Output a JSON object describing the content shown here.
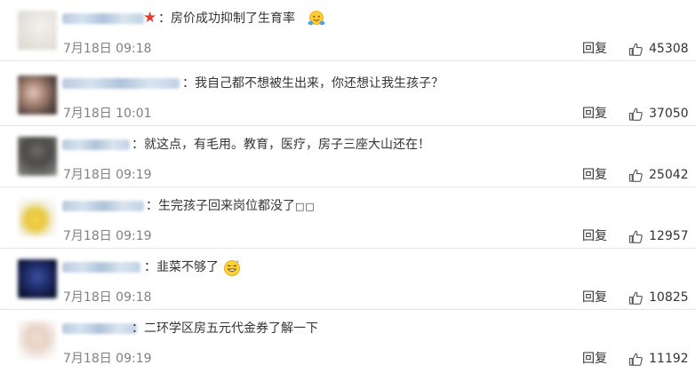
{
  "reply_label": "回复",
  "icons": {
    "like": "thumbs-up-icon",
    "star": "red-star-icon"
  },
  "colors": {
    "text": "#333333",
    "meta": "#808080",
    "name_blur": "#b9cbe0",
    "star": "#e23c2a",
    "divider": "#e6e6e6"
  },
  "comments": [
    {
      "prefix": "：",
      "text": "房价成功抑制了生育率",
      "emoji": "hug-emoji",
      "time": "7月18日 09:18",
      "likes": "45308",
      "has_star": true
    },
    {
      "prefix": "：",
      "text": "我自己都不想被生出来，你还想让我生孩子？",
      "time": "7月18日 10:01",
      "likes": "37050"
    },
    {
      "prefix": "：",
      "text": "就这点，有毛用。教育，医疗，房子三座大山还在！",
      "time": "7月18日 09:19",
      "likes": "25042"
    },
    {
      "prefix": "：",
      "text": "生完孩子回来岗位都没了",
      "tofu": "□□",
      "time": "7月18日 09:19",
      "likes": "12957"
    },
    {
      "prefix": "：",
      "text": "韭菜不够了",
      "emoji": "sweat-grin-emoji",
      "time": "7月18日 09:18",
      "likes": "10825"
    },
    {
      "prefix": "：",
      "text": "二环学区房五元代金券了解一下",
      "time": "7月18日 09:19",
      "likes": "11192"
    }
  ]
}
